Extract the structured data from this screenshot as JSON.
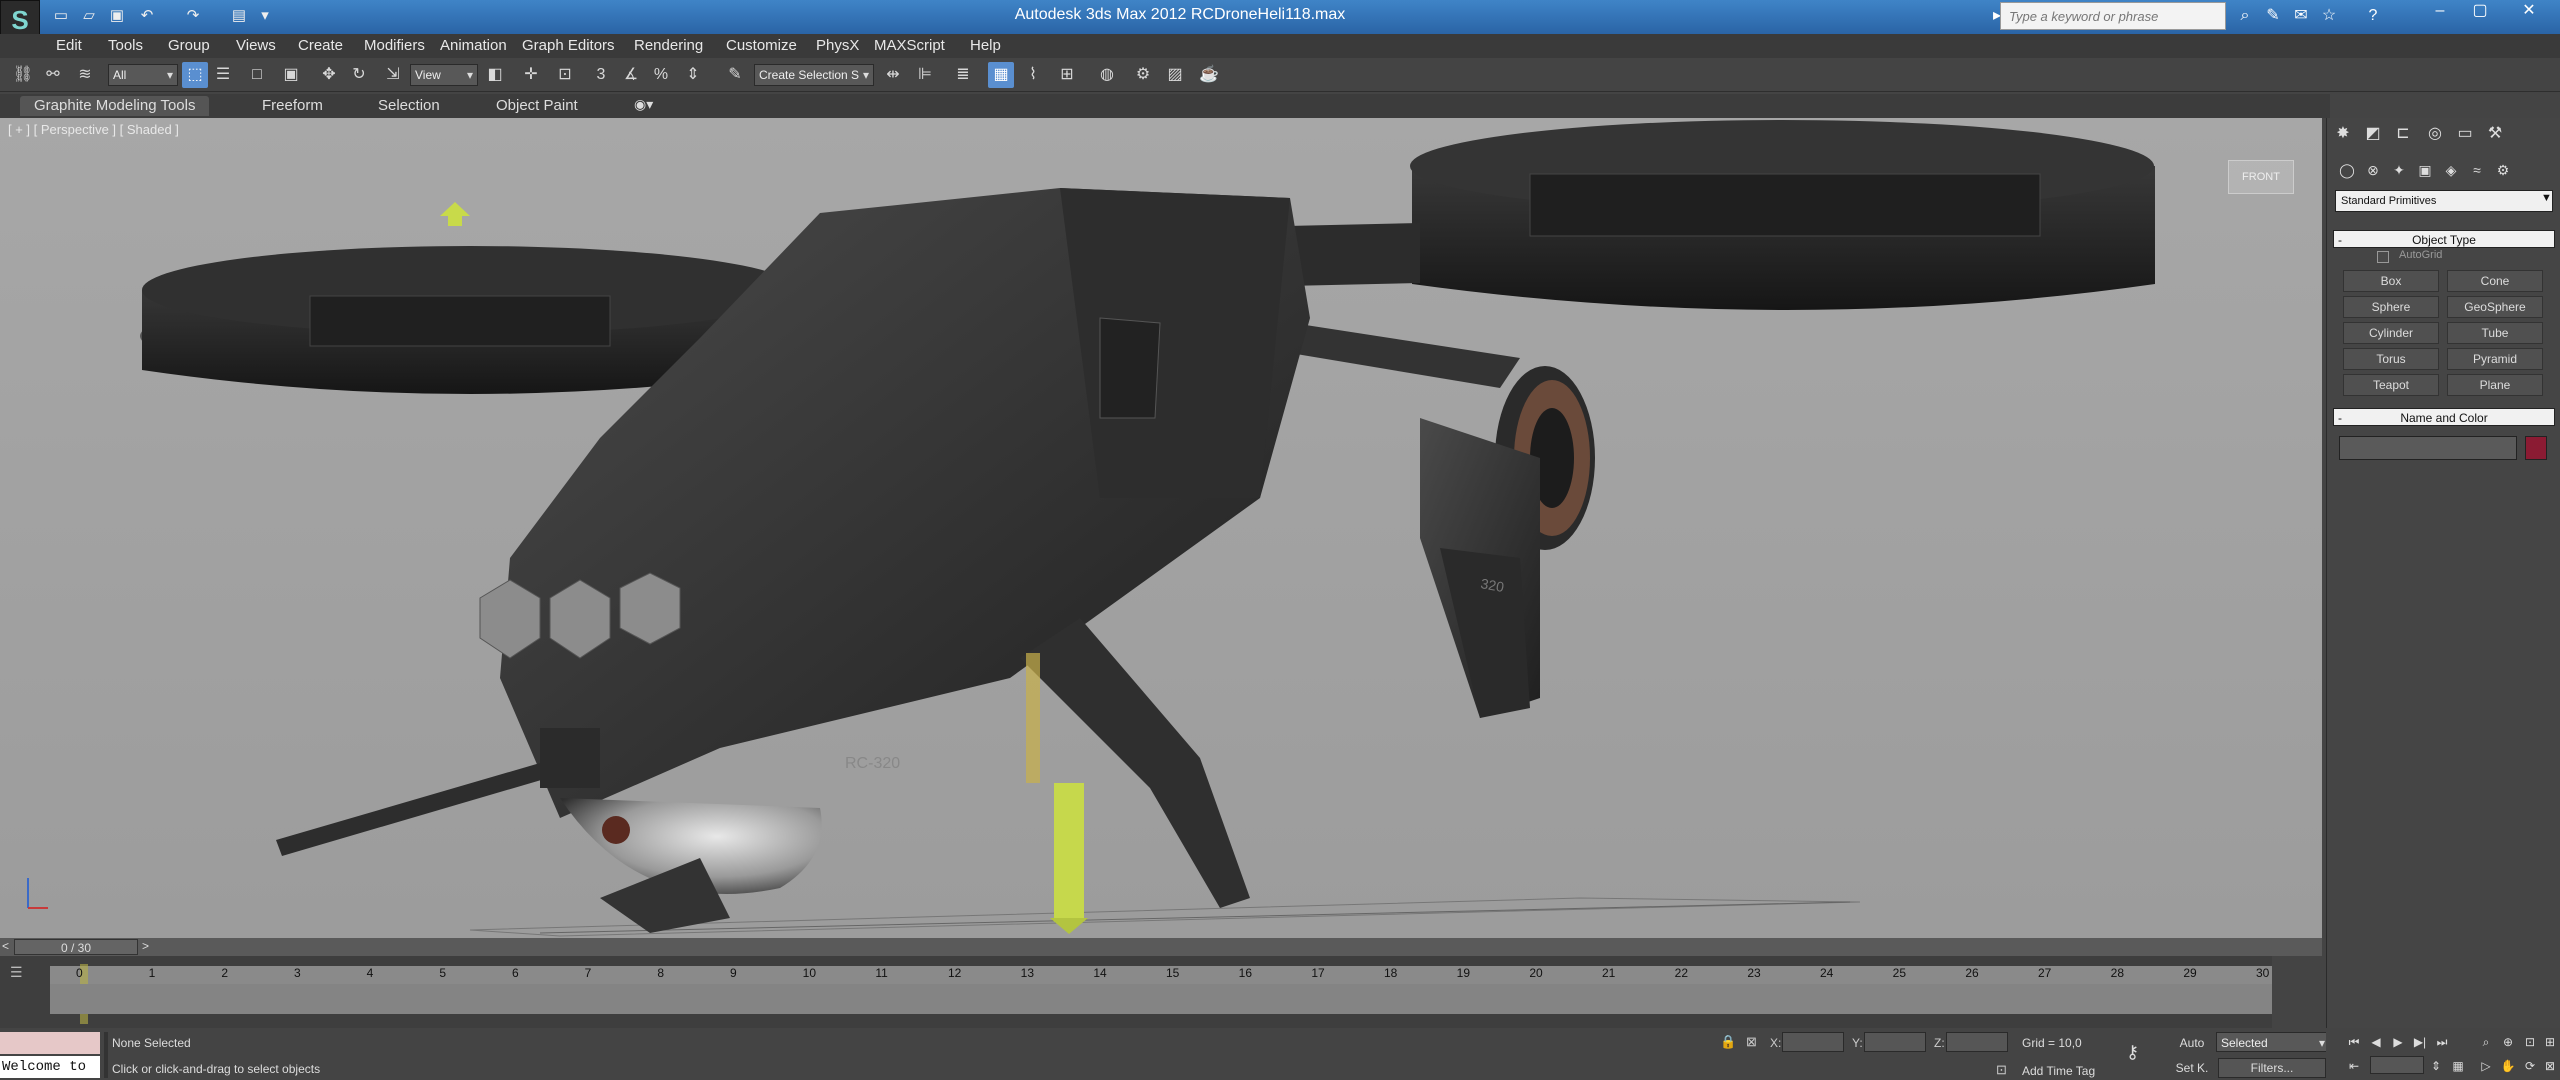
{
  "window": {
    "title": "Autodesk 3ds Max  2012      RCDroneHeli118.max",
    "search_placeholder": "Type a keyword or phrase",
    "logo": "3ds-max-logo"
  },
  "menu": [
    "Edit",
    "Tools",
    "Group",
    "Views",
    "Create",
    "Modifiers",
    "Animation",
    "Graph Editors",
    "Rendering",
    "Customize",
    "PhysX",
    "MAXScript",
    "Help"
  ],
  "toolbar": {
    "selection_filter": "All",
    "ref_coord": "View",
    "named_selection": "Create Selection S"
  },
  "ribbon": {
    "tabs": [
      "Graphite Modeling Tools",
      "Freeform",
      "Selection",
      "Object Paint"
    ]
  },
  "viewport": {
    "label": "[ + ] [ Perspective ] [ Shaded ]",
    "viewcube_label": "FRONT",
    "model_markings": [
      "RC-320",
      "320"
    ]
  },
  "command_panel": {
    "category": "Standard Primitives",
    "object_type_title": "Object Type",
    "autogrid_label": "AutoGrid",
    "buttons": [
      "Box",
      "Cone",
      "Sphere",
      "GeoSphere",
      "Cylinder",
      "Tube",
      "Torus",
      "Pyramid",
      "Teapot",
      "Plane"
    ],
    "name_color_title": "Name and Color",
    "object_color": "#8b1b33"
  },
  "timeline": {
    "frame_counter": "0 / 30",
    "ticks": [
      "0",
      "1",
      "2",
      "3",
      "4",
      "5",
      "6",
      "7",
      "8",
      "9",
      "10",
      "11",
      "12",
      "13",
      "14",
      "15",
      "16",
      "17",
      "18",
      "19",
      "20",
      "21",
      "22",
      "23",
      "24",
      "25",
      "26",
      "27",
      "28",
      "29",
      "30"
    ]
  },
  "status": {
    "maxscript_text": "Welcome to",
    "selection_status": "None Selected",
    "prompt": "Click or click-and-drag to select objects",
    "x_label": "X:",
    "y_label": "Y:",
    "z_label": "Z:",
    "grid": "Grid = 10,0",
    "add_time_tag": "Add Time Tag",
    "auto_key": "Auto",
    "set_key": "Set K.",
    "key_mode": "Selected",
    "filters": "Filters..."
  }
}
